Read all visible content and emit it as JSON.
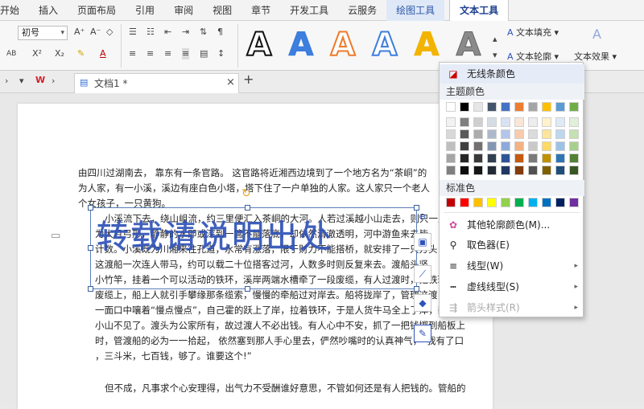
{
  "menubar": {
    "items": [
      "开始",
      "插入",
      "页面布局",
      "引用",
      "审阅",
      "视图",
      "章节",
      "开发工具",
      "云服务",
      "绘图工具",
      "文本工具"
    ]
  },
  "ribbon": {
    "font_size": "初号",
    "text_fill": "文本填充",
    "text_outline": "文本轮廓",
    "text_effect": "文本效果",
    "wordart_glyph": "A",
    "wordart_styles": [
      {
        "fill": "#ffffff",
        "stroke": "#111111",
        "style": "black-outline"
      },
      {
        "fill": "#3d7ede",
        "stroke": "#3d7ede",
        "style": "blue-solid"
      },
      {
        "fill": "#ffffff",
        "stroke": "#ee7a2a",
        "style": "orange-outline"
      },
      {
        "fill": "#ffffff",
        "stroke": "#3d7ede",
        "style": "blue-outline"
      },
      {
        "fill": "#f2b400",
        "stroke": "#f2b400",
        "style": "gold-solid"
      },
      {
        "fill": "#8a8a8a",
        "stroke": "#666666",
        "style": "gray-gradient"
      }
    ]
  },
  "tabbar": {
    "doc_tab": "文档1 *",
    "close": "×",
    "add": "+"
  },
  "document": {
    "paragraph1": [
      "由四川过湖南去， 靠东有一条官路。 这官路将近湘西边境到了一个地方名为“茶峒”的",
      "为人家，有一小溪，溪边有座白色小塔，塔下住了一户单独的人家。这人家只一个老人",
      "个女孩子，一只黄狗。"
    ],
    "paragraph2": [
      "小溪流下去，绕山岨流，约三里便汇入茶峒的大河。人若过溪越小山走去，则只一里",
      "为大月弓形，静静的水即或深到一篙不能落底，却依然清澈透明，河中游鱼来去皆",
      "计数。小溪既为川湘来往孔道，水常有涨落，限于财力不能搭桥，就安排了一只方头",
      "这渡船一次连人带马，约可以载二十位搭客过河，人数多时则反复来去。渡船头竖",
      "小竹竿，挂着一个可以活动的铁环，溪岸两端水槽牵了一段废缆，有人过渡时，把铁环",
      "废缆上，船上人就引手攀缘那条缆索，慢慢的牵船过对岸去。船将拢岸了，管理这渡",
      "一面口中嚷着“慢点慢点”，自己霍的跃上了岸，拉着铁环，于是人货牛马全上了岸，翻过",
      "小山不见了。渡头为公家所有，故过渡人不必出钱。有人心中不安，抓了一把钱掷到船板上",
      "时，管渡船的必为一一拾起， 依然塞到那人手心里去，俨然吵嘴时的认真神气，“我有了口",
      "，三斗米，七百钱，够了。谁要这个!”"
    ],
    "paragraph3": [
      "但不成，凡事求个心安理得，出气力不受酬谁好意思，不管如何还是有人把钱的。管船的"
    ],
    "wordart": "转载请说明出处"
  },
  "dropdown": {
    "no_outline": "无线条颜色",
    "theme_colors": "主题颜色",
    "standard_colors": "标准色",
    "other_colors": "其他轮廓颜色(M)...",
    "eyedropper": "取色器(E)",
    "line_style": "线型(W)",
    "dash_style": "虚线线型(S)",
    "arrow_style": "箭头样式(R)",
    "theme_top_row": [
      "#ffffff",
      "#000000",
      "#e7e6e6",
      "#44546a",
      "#4472c4",
      "#ed7d31",
      "#a5a5a5",
      "#ffc000",
      "#5b9bd5",
      "#70ad47"
    ],
    "theme_tints": [
      [
        "#f2f2f2",
        "#7f7f7f",
        "#d0cece",
        "#d6dce4",
        "#d9e2f3",
        "#fbe5d6",
        "#ededed",
        "#fff2cc",
        "#deebf6",
        "#e2efd9"
      ],
      [
        "#d8d8d8",
        "#595959",
        "#aeabab",
        "#adb9ca",
        "#b4c6e7",
        "#f7cbac",
        "#dbdbdb",
        "#fee599",
        "#bdd7ee",
        "#c5e0b3"
      ],
      [
        "#bfbfbf",
        "#3f3f3f",
        "#757070",
        "#8496b0",
        "#8eaadb",
        "#f4b183",
        "#c9c9c9",
        "#ffd965",
        "#9cc3e5",
        "#a8d08d"
      ],
      [
        "#a5a5a5",
        "#262626",
        "#3a3838",
        "#323f4f",
        "#2f5496",
        "#c55a11",
        "#7b7b7b",
        "#bf9000",
        "#2e75b5",
        "#538135"
      ],
      [
        "#7f7f7f",
        "#0c0c0c",
        "#171616",
        "#222a35",
        "#1f3864",
        "#833c0b",
        "#525252",
        "#7f6000",
        "#1e4e79",
        "#375623"
      ]
    ],
    "standard": [
      "#c00000",
      "#ff0000",
      "#ffc000",
      "#ffff00",
      "#92d050",
      "#00b050",
      "#00b0f0",
      "#0070c0",
      "#002060",
      "#7030a0"
    ]
  }
}
